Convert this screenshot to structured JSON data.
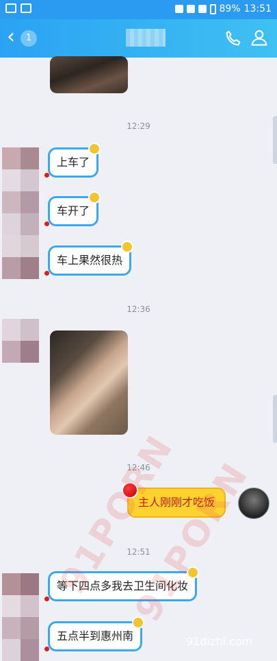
{
  "status": {
    "battery": "89%",
    "time": "13:51"
  },
  "header": {
    "back_count": "1",
    "call_icon": "phone-icon",
    "profile_icon": "person-icon"
  },
  "timestamps": [
    "12:29",
    "12:36",
    "12:46",
    "12:51"
  ],
  "incoming": [
    {
      "text": "上车了"
    },
    {
      "text": "车开了"
    },
    {
      "text": "车上果然很热"
    },
    {
      "text": "等下四点多我去卫生间化妆"
    },
    {
      "text": "五点半到惠州南"
    }
  ],
  "outgoing": [
    {
      "text": "主人刚刚才吃饭"
    }
  ],
  "watermark": {
    "line1": "91PORN",
    "line2": "91PORN",
    "site": "91dizhi.com"
  },
  "colors": {
    "header": "#2aa3f3",
    "bubble_border": "#3aa8f1",
    "my_bubble": "#ffd230",
    "my_text": "#c21c1c"
  }
}
